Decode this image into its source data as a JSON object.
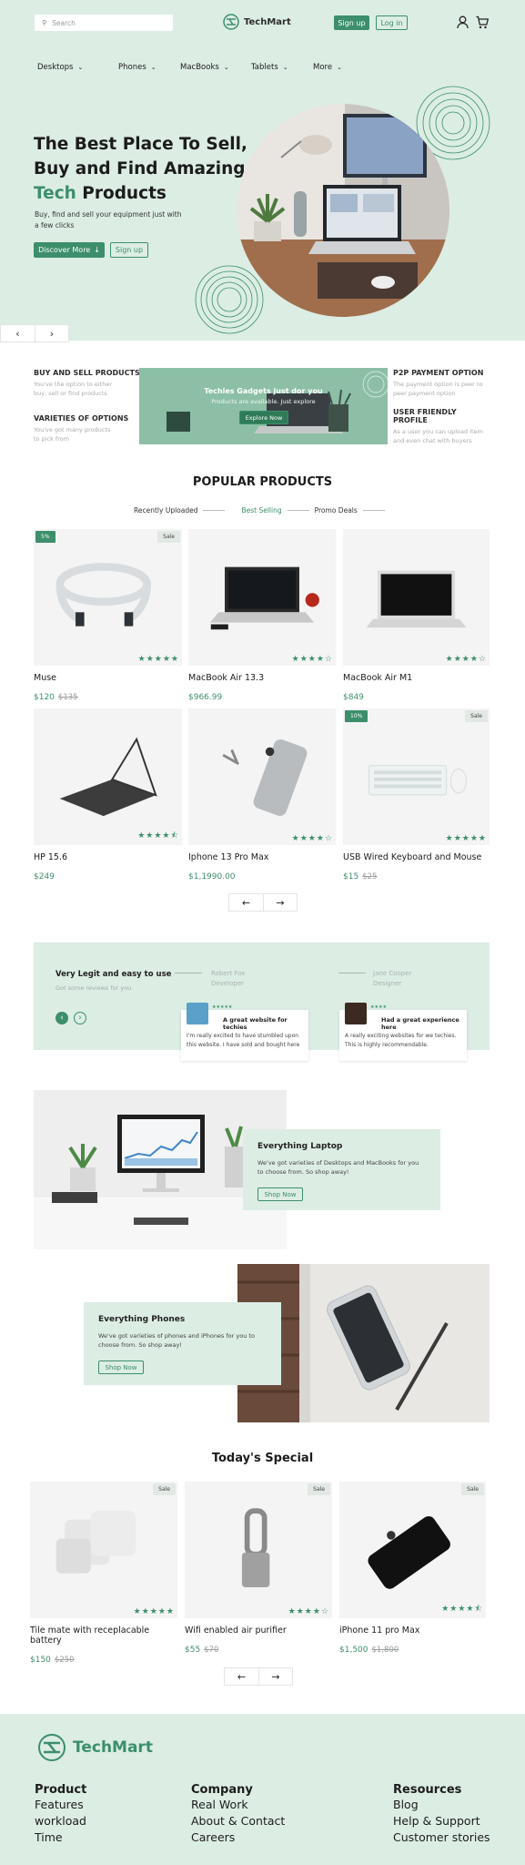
{
  "header": {
    "search_placeholder": "Search",
    "brand": "TechMart",
    "signup": "Sign up",
    "login": "Log in"
  },
  "nav": [
    "Desktops",
    "Phones",
    "MacBooks",
    "Tablets",
    "More"
  ],
  "hero": {
    "line1": "The Best Place To Sell,",
    "line2": "Buy and Find Amazing",
    "accent": "Tech",
    "rest": " Products",
    "sub1": "Buy, find and sell your equipment just with",
    "sub2": "a few clicks",
    "discover": "Discover More",
    "signup": "Sign up"
  },
  "features": {
    "left": [
      {
        "title": "BUY AND SELL PRODUCTS",
        "d1": "You've the option to either",
        "d2": "buy, sell or find products"
      },
      {
        "title": "VARIETIES OF OPTIONS",
        "d1": "You've got many products",
        "d2": "to pick from"
      }
    ],
    "banner": {
      "title": "Techies Gadgets just dor you",
      "sub": "Products are available. Just explore",
      "cta": "Explore Now"
    },
    "right": [
      {
        "title": "P2P PAYMENT OPTION",
        "d1": "The payment option is peer to",
        "d2": "peer payment option"
      },
      {
        "title": "USER FRIENDLY PROFILE",
        "d1": "As a user you can upload item",
        "d2": "and even chat with buyers"
      }
    ]
  },
  "popular": {
    "title": "POPULAR PRODUCTS",
    "tabs": [
      "Recently Uploaded",
      "Best Selling",
      "Promo Deals"
    ],
    "products": [
      {
        "name": "Muse",
        "price": "$120",
        "old": "$135",
        "badge": "5%",
        "tag": "Sale",
        "rating": 5
      },
      {
        "name": "MacBook Air 13.3",
        "price": "$966.99",
        "old": "",
        "badge": "",
        "tag": "",
        "rating": 4
      },
      {
        "name": "MacBook Air M1",
        "price": "$849",
        "old": "",
        "badge": "",
        "tag": "",
        "rating": 4
      },
      {
        "name": "HP 15.6",
        "price": "$249",
        "old": "",
        "badge": "",
        "tag": "",
        "rating": 4.5
      },
      {
        "name": "Iphone 13 Pro Max",
        "price": "$1,1990.00",
        "old": "",
        "badge": "",
        "tag": "",
        "rating": 4
      },
      {
        "name": "USB Wired Keyboard and Mouse",
        "price": "$15",
        "old": "$25",
        "badge": "10%",
        "tag": "Sale",
        "rating": 5
      }
    ]
  },
  "reviews": {
    "title": "Very Legit and easy to use",
    "sub": "Got some reviews for you",
    "items": [
      {
        "name": "Robert Fox",
        "role": "Developer",
        "headline": "A great website for techies",
        "text1": "I'm really excited to have stumbled upon",
        "text2": "this website. I have sold and bought here"
      },
      {
        "name": "Jane Cooper",
        "role": "Designer",
        "headline": "Had a great experience here",
        "text1": "A really exciting websites for we techies.",
        "text2": "This is highly recommendable."
      }
    ]
  },
  "laptop": {
    "title": "Everything Laptop",
    "d1": "We've got varieties of Desktops and MacBooks for you",
    "d2": "to choose from. So shop away!",
    "cta": "Shop Now"
  },
  "phones": {
    "title": "Everything Phones",
    "d1": "We've got varieties of phones and iPhones for you to",
    "d2": "choose from. So shop away!",
    "cta": "Shop Now"
  },
  "special": {
    "title": "Today's Special",
    "products": [
      {
        "name": "Tile mate with receplacable battery",
        "price": "$150",
        "old": "$250",
        "tag": "Sale",
        "rating": 5
      },
      {
        "name": "Wifi enabled air purifier",
        "price": "$55",
        "old": "$70",
        "tag": "Sale",
        "rating": 4
      },
      {
        "name": "iPhone 11 pro Max",
        "price": "$1,500",
        "old": "$1,800",
        "tag": "Sale",
        "rating": 4.5
      }
    ]
  },
  "footer": {
    "brand": "TechMart",
    "cols": [
      {
        "title": "Product",
        "links": [
          "Features",
          "workload",
          "Time"
        ]
      },
      {
        "title": "Company",
        "links": [
          "Real Work",
          "About & Contact",
          "Careers"
        ]
      },
      {
        "title": "Resources",
        "links": [
          "Blog",
          "Help & Support",
          "Customer stories"
        ]
      }
    ]
  }
}
